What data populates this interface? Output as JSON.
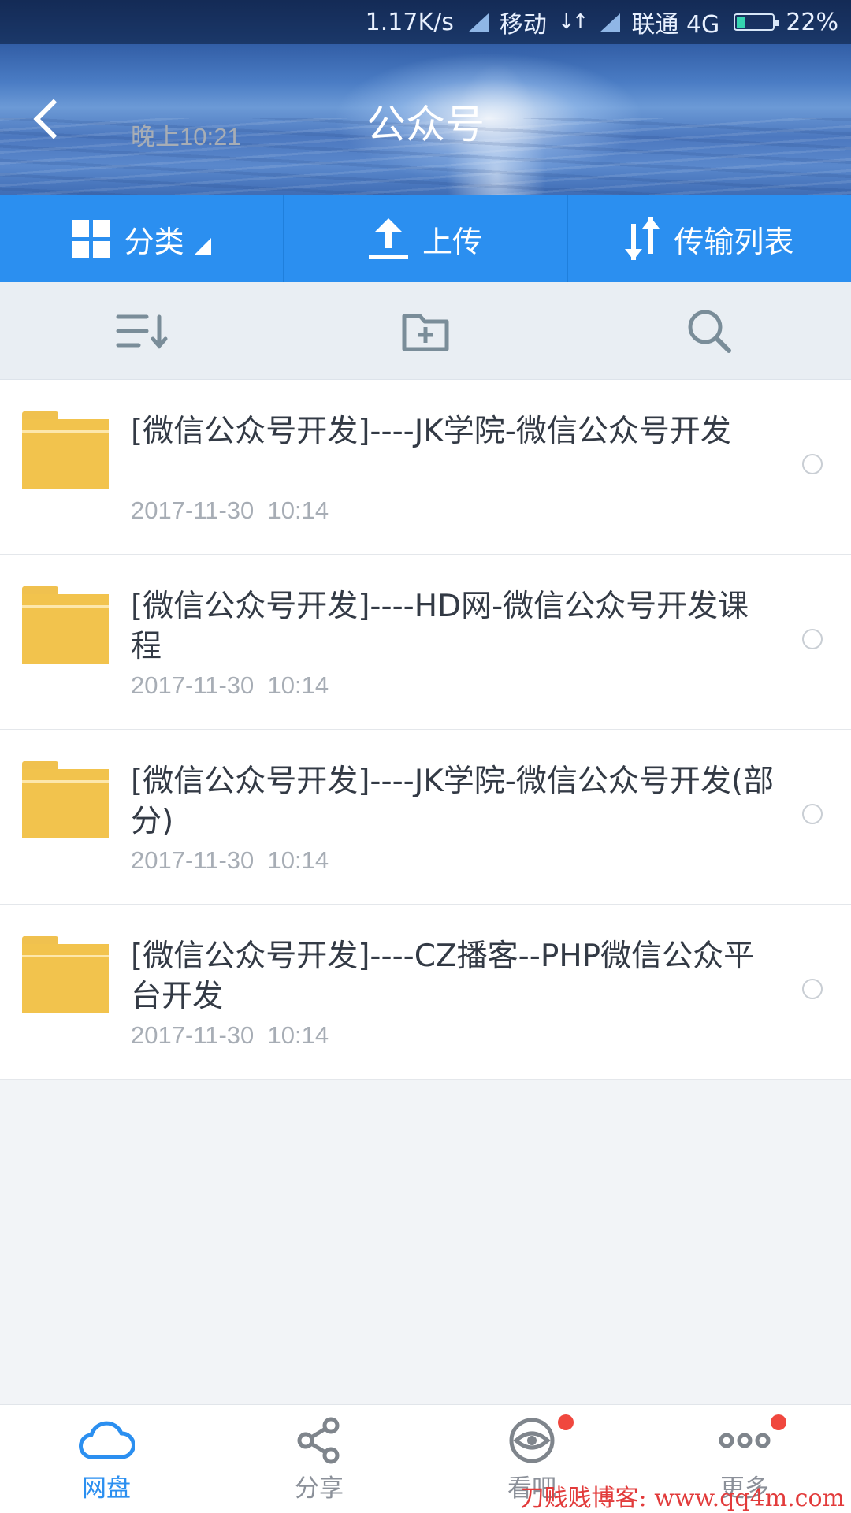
{
  "status_bar": {
    "time": "晚上10:21",
    "speed": "1.17K/s",
    "carrier1": "移动",
    "carrier2": "联通 4G",
    "battery": "22%",
    "battery_level": 0.22
  },
  "header": {
    "title": "公众号"
  },
  "toolbar": {
    "category_label": "分类",
    "upload_label": "上传",
    "transfer_label": "传输列表"
  },
  "subbar": {
    "icons": [
      "sort-icon",
      "new-folder-icon",
      "search-icon"
    ]
  },
  "files": [
    {
      "name": "[微信公众号开发]----JK学院-微信公众号开发",
      "time": "2017-11-30  10:14"
    },
    {
      "name": "[微信公众号开发]----HD网-微信公众号开发课程",
      "time": "2017-11-30  10:14"
    },
    {
      "name": "[微信公众号开发]----JK学院-微信公众号开发(部分)",
      "time": "2017-11-30  10:14"
    },
    {
      "name": "[微信公众号开发]----CZ播客--PHP微信公众平台开发",
      "time": "2017-11-30  10:14"
    }
  ],
  "bottom_nav": [
    {
      "label": "网盘",
      "icon": "cloud-icon",
      "active": true
    },
    {
      "label": "分享",
      "icon": "share-icon",
      "active": false
    },
    {
      "label": "看吧",
      "icon": "eye-icon",
      "active": false,
      "badge": true
    },
    {
      "label": "更多",
      "icon": "more-icon",
      "active": false,
      "badge": true
    }
  ],
  "watermark": "刀贱贱博客: www.qq4m.com",
  "colors": {
    "accent": "#2b8ff0",
    "folder": "#f2c34d",
    "badge": "#f0473e"
  }
}
